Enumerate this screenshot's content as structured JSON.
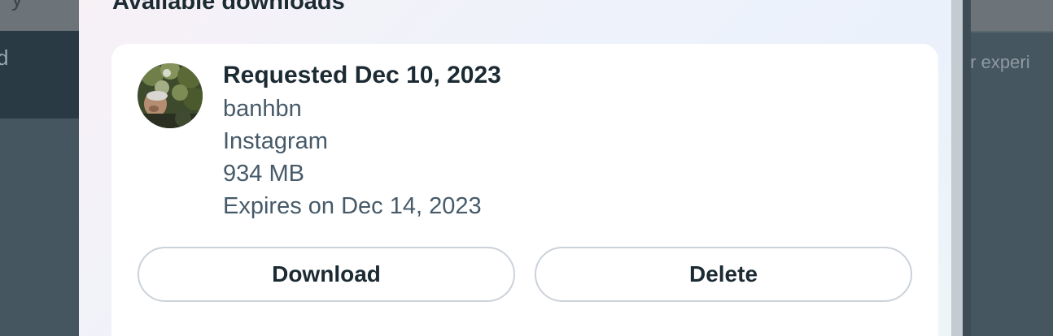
{
  "background": {
    "left_text": "d",
    "top_left_glyph": "y",
    "right_text": "ur experi"
  },
  "modal": {
    "title": "Available downloads"
  },
  "download_item": {
    "requested": "Requested Dec 10, 2023",
    "username": "banhbn",
    "platform": "Instagram",
    "size": "934 MB",
    "expires": "Expires on Dec 14, 2023",
    "avatar_icon": "profile-photo"
  },
  "actions": {
    "download_label": "Download",
    "delete_label": "Delete"
  }
}
